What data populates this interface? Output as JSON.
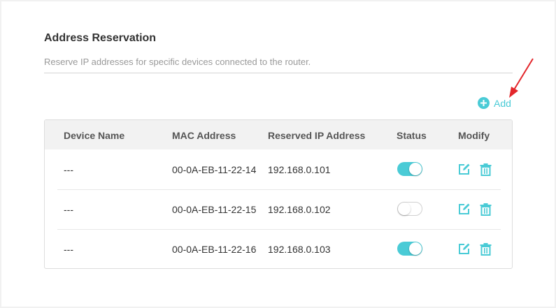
{
  "section": {
    "title": "Address Reservation",
    "subtitle": "Reserve IP addresses for specific devices connected to the router."
  },
  "actions": {
    "add_label": "Add",
    "add_icon": "plus-circle-icon",
    "annotation_icon": "red-arrow-icon"
  },
  "table": {
    "headers": [
      "Device Name",
      "MAC Address",
      "Reserved IP Address",
      "Status",
      "Modify"
    ],
    "rows": [
      {
        "device": "---",
        "mac": "00-0A-EB-11-22-14",
        "ip": "192.168.0.101",
        "status": "on"
      },
      {
        "device": "---",
        "mac": "00-0A-EB-11-22-15",
        "ip": "192.168.0.102",
        "status": "off"
      },
      {
        "device": "---",
        "mac": "00-0A-EB-11-22-16",
        "ip": "192.168.0.103",
        "status": "on"
      }
    ],
    "modify_icons": [
      "edit-icon",
      "trash-icon"
    ]
  },
  "colors": {
    "accent": "#4acbd6",
    "annotation_arrow": "#e3262b",
    "title_text": "#333333",
    "muted_text": "#999999"
  }
}
